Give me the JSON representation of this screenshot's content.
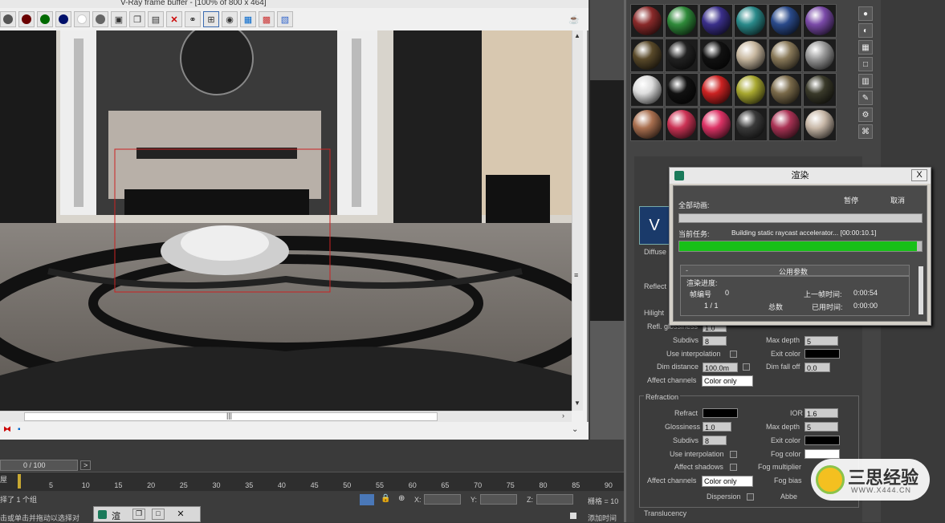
{
  "vfb": {
    "title": "V-Ray frame buffer - [100% of 800 x 464]",
    "toolbar_icons": [
      "rgb-channel-icon",
      "red-channel-icon",
      "green-channel-icon",
      "blue-channel-icon",
      "alpha-channel-icon",
      "mono-icon",
      "save-icon",
      "copy-icon",
      "open-icon",
      "clear-icon",
      "link-icon",
      "region-render-icon",
      "render-icon",
      "camera-icon",
      "lut-icon",
      "corrections-icon",
      "teapot-icon"
    ]
  },
  "timeline": {
    "frame_counter": "0 / 100",
    "next_label": ">",
    "ticks": [
      "5",
      "10",
      "15",
      "20",
      "25",
      "30",
      "35",
      "40",
      "45",
      "50",
      "55",
      "60",
      "65",
      "70",
      "75",
      "80",
      "85",
      "90"
    ]
  },
  "status": {
    "selection": "择了 1 个组",
    "prompt": "击或单击并拖动以选择对",
    "x_label": "X:",
    "y_label": "Y:",
    "z_label": "Z:",
    "grid": "栅格 = 10",
    "add_time": "添加时间"
  },
  "taskbar": {
    "label": "渲"
  },
  "material": {
    "slot_colors": [
      "#8a2a2a",
      "#2f8a3a",
      "#3a2f8a",
      "#2a8a8a",
      "#2a4a8a",
      "#7a4aa8",
      "#5a4a2a",
      "#222222",
      "#111111",
      "#c8b8a0",
      "#8a7a5a",
      "#9a9a9a",
      "#dddddd",
      "#111111",
      "#cc2222",
      "#a8a830",
      "#7a6a4a",
      "#3a3a2a",
      "#aa7050",
      "#cc3355",
      "#dd3366",
      "#3a3a3a",
      "#aa3355",
      "#c8b8a8"
    ],
    "diffuse_label": "Diffuse",
    "reflect_group": "Reflect",
    "hilight_label": "Hilight",
    "refl_gloss_label": "Refl. glossiness",
    "refl_gloss_value": "1.0",
    "subdivs_label": "Subdivs",
    "subdivs_value": "8",
    "use_interp_label": "Use interpolation",
    "dim_distance_label": "Dim distance",
    "dim_distance_value": "100.0m",
    "affect_channels_label": "Affect channels",
    "affect_channels_value": "Color only",
    "max_depth_label": "Max depth",
    "max_depth_value": "5",
    "exit_color_label": "Exit color",
    "dim_falloff_label": "Dim fall off",
    "dim_falloff_value": "0.0",
    "refraction_group": "Refraction",
    "refract_label": "Refract",
    "ior_label": "IOR",
    "ior_value": "1.6",
    "glossiness_label": "Glossiness",
    "glossiness_value": "1.0",
    "r_max_depth_value": "5",
    "r_subdivs_value": "8",
    "r_exit_color_label": "Exit color",
    "fog_color_label": "Fog color",
    "affect_shadows_label": "Affect shadows",
    "fog_multiplier_label": "Fog multiplier",
    "r_affect_channels_value": "Color only",
    "fog_bias_label": "Fog bias",
    "dispersion_label": "Dispersion",
    "abbe_label": "Abbe",
    "translucency_label": "Translucency"
  },
  "render_dialog": {
    "title": "渲染",
    "close": "X",
    "total_anim_label": "全部动画:",
    "pause_label": "暂停",
    "cancel_label": "取消",
    "current_task_label": "当前任务:",
    "current_task_value": "Building static raycast accelerator... [00:00:10.1]",
    "progress": 0.98,
    "rollout_minus": "-",
    "rollout_title": "公用参数",
    "render_progress_label": "渲染进度:",
    "frame_no_label": "帧编号",
    "frame_no_value": "0",
    "last_frame_time_label": "上一帧时间:",
    "last_frame_time_value": "0:00:54",
    "frames_value": "1 / 1",
    "total_label": "总数",
    "elapsed_label": "已用时间:",
    "elapsed_value": "0:00:00"
  },
  "watermark": {
    "brand": "三思经验",
    "url": "WWW.X444.CN"
  }
}
